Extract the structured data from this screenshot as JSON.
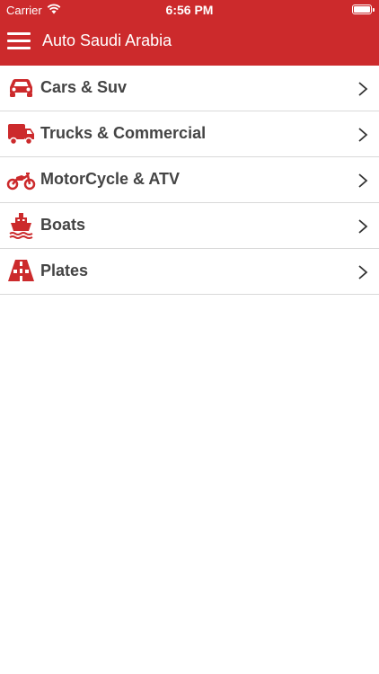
{
  "status": {
    "carrier": "Carrier",
    "time": "6:56 PM"
  },
  "header": {
    "title": "Auto Saudi Arabia"
  },
  "categories": [
    {
      "label": "Cars & Suv",
      "icon": "car-icon"
    },
    {
      "label": "Trucks & Commercial",
      "icon": "truck-icon"
    },
    {
      "label": "MotorCycle & ATV",
      "icon": "motorcycle-icon"
    },
    {
      "label": "Boats",
      "icon": "boat-icon"
    },
    {
      "label": "Plates",
      "icon": "plates-icon"
    }
  ],
  "colors": {
    "brand": "#cc2a2c",
    "text": "#444444",
    "divider": "#d9d9d9"
  }
}
